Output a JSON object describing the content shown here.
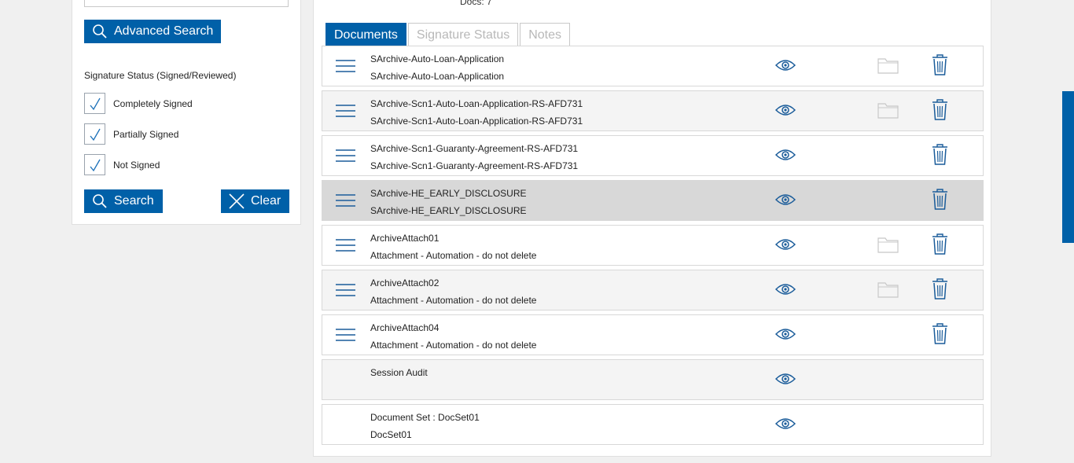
{
  "filters": {
    "advanced_search_label": "Advanced Search",
    "signature_status_title": "Signature Status (Signed/Reviewed)",
    "checkboxes": [
      {
        "label": "Completely Signed",
        "checked": true
      },
      {
        "label": "Partially Signed",
        "checked": true
      },
      {
        "label": "Not Signed",
        "checked": true
      }
    ],
    "search_label": "Search",
    "clear_label": "Clear"
  },
  "main": {
    "docs_count": "Docs: 7",
    "tabs": [
      {
        "label": "Documents",
        "active": true
      },
      {
        "label": "Signature Status",
        "active": false
      },
      {
        "label": "Notes",
        "active": false
      }
    ],
    "documents": [
      {
        "title": "SArchive-Auto-Loan-Application",
        "subtitle": "SArchive-Auto-Loan-Application",
        "has_menu": true,
        "has_folder": true,
        "has_trash": true,
        "style": "normal"
      },
      {
        "title": "SArchive-Scn1-Auto-Loan-Application-RS-AFD731",
        "subtitle": "SArchive-Scn1-Auto-Loan-Application-RS-AFD731",
        "has_menu": true,
        "has_folder": true,
        "has_trash": true,
        "style": "alt"
      },
      {
        "title": "SArchive-Scn1-Guaranty-Agreement-RS-AFD731",
        "subtitle": "SArchive-Scn1-Guaranty-Agreement-RS-AFD731",
        "has_menu": true,
        "has_folder": false,
        "has_trash": true,
        "style": "normal"
      },
      {
        "title": "SArchive-HE_EARLY_DISCLOSURE",
        "subtitle": "SArchive-HE_EARLY_DISCLOSURE",
        "has_menu": true,
        "has_folder": false,
        "has_trash": true,
        "style": "sel"
      },
      {
        "title": "ArchiveAttach01",
        "subtitle": "Attachment - Automation - do not delete",
        "has_menu": true,
        "has_folder": true,
        "has_trash": true,
        "style": "normal"
      },
      {
        "title": "ArchiveAttach02",
        "subtitle": "Attachment - Automation - do not delete",
        "has_menu": true,
        "has_folder": true,
        "has_trash": true,
        "style": "alt"
      },
      {
        "title": "ArchiveAttach04",
        "subtitle": "Attachment - Automation - do not delete",
        "has_menu": true,
        "has_folder": false,
        "has_trash": true,
        "style": "normal"
      },
      {
        "title": "Session Audit",
        "subtitle": "",
        "has_menu": false,
        "has_folder": false,
        "has_trash": false,
        "style": "alt"
      },
      {
        "title": "Document Set : DocSet01",
        "subtitle": "DocSet01",
        "has_menu": false,
        "has_folder": false,
        "has_trash": false,
        "style": "normal"
      }
    ]
  },
  "colors": {
    "accent": "#0060a8",
    "icon": "#1a5c9a",
    "folder": "#c8c8c8"
  }
}
